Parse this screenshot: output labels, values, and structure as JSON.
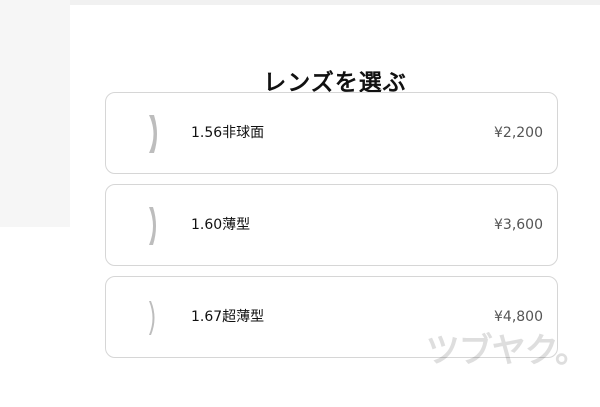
{
  "page": {
    "title": "レンズを選ぶ"
  },
  "lenses": [
    {
      "name": "1.56非球面",
      "price": "¥2,200",
      "icon": "lens-thick-icon",
      "thickness": 5
    },
    {
      "name": "1.60薄型",
      "price": "¥3,600",
      "icon": "lens-thin-icon",
      "thickness": 4
    },
    {
      "name": "1.67超薄型",
      "price": "¥4,800",
      "icon": "lens-ultra-thin-icon",
      "thickness": 3
    }
  ],
  "watermark": "ツブヤク。",
  "colors": {
    "card_border": "#d6d6d6",
    "lens_fill": "#bdbdbd",
    "price_text": "#555555",
    "left_panel": "#f6f6f6"
  }
}
